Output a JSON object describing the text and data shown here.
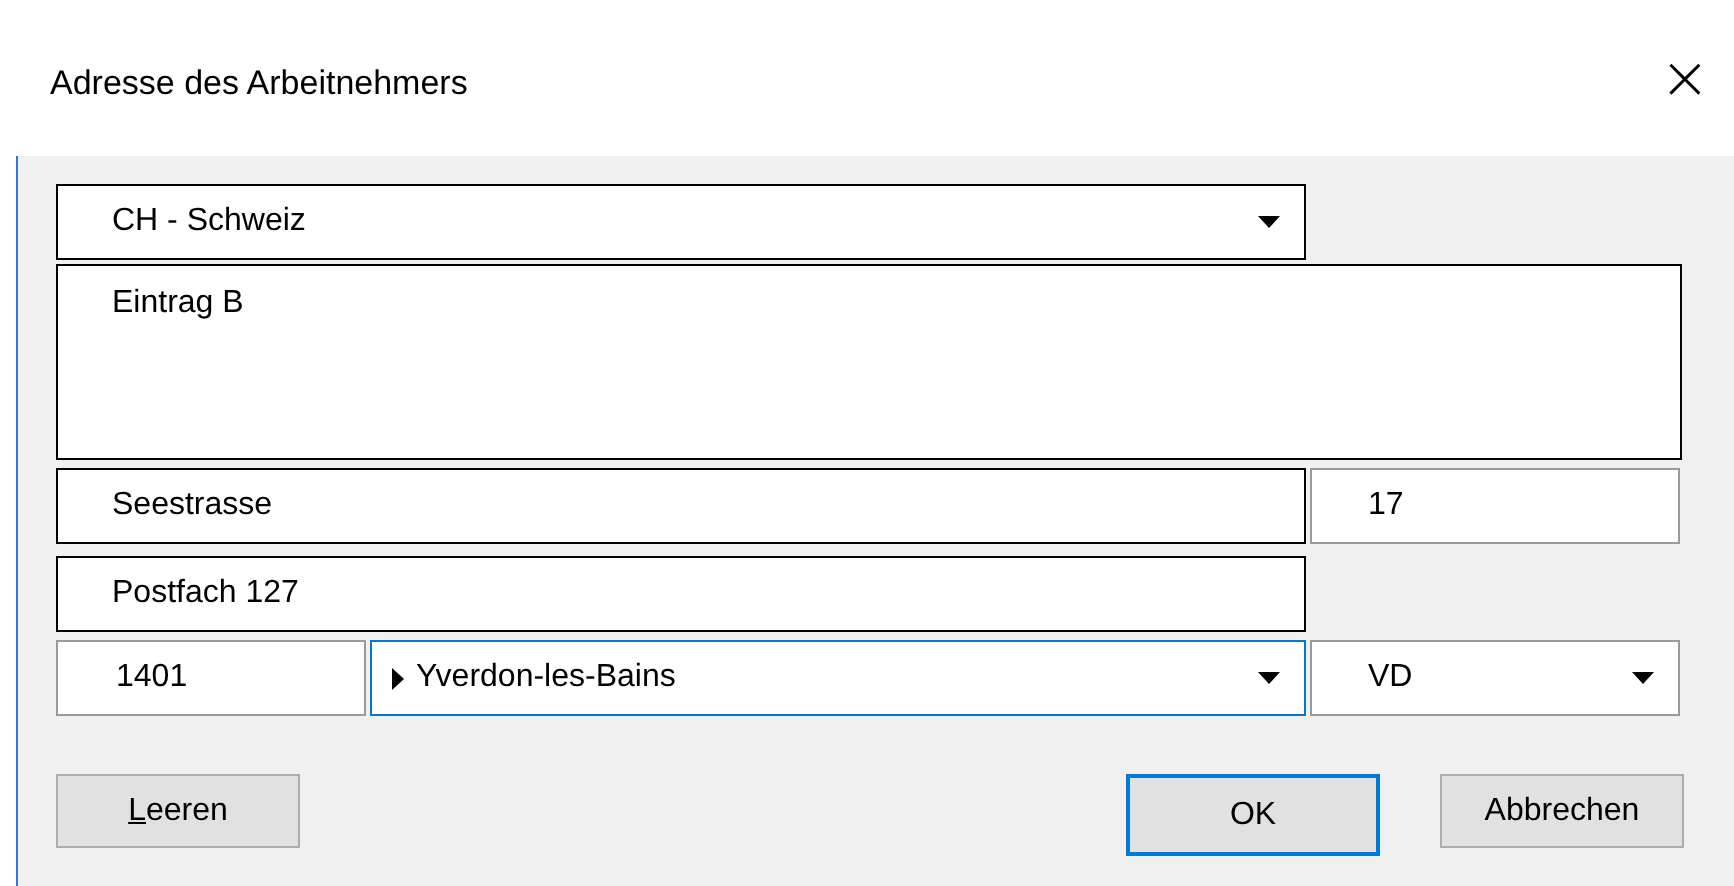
{
  "window": {
    "title": "Adresse des Arbeitnehmers",
    "close": "×"
  },
  "country": {
    "value": "CH - Schweiz"
  },
  "memo": {
    "value": "Eintrag B"
  },
  "street": {
    "value": "Seestrasse"
  },
  "house_number": {
    "value": "17"
  },
  "po_box": {
    "value": "Postfach 127"
  },
  "zip": {
    "value": "1401"
  },
  "city": {
    "value": "Yverdon-les-Bains",
    "focused": true
  },
  "canton": {
    "value": "VD"
  },
  "buttons": [
    {
      "label": "Leeren",
      "default": false
    },
    {
      "label": "OK",
      "default": true
    },
    {
      "label": "Abbrechen",
      "default": false
    }
  ]
}
